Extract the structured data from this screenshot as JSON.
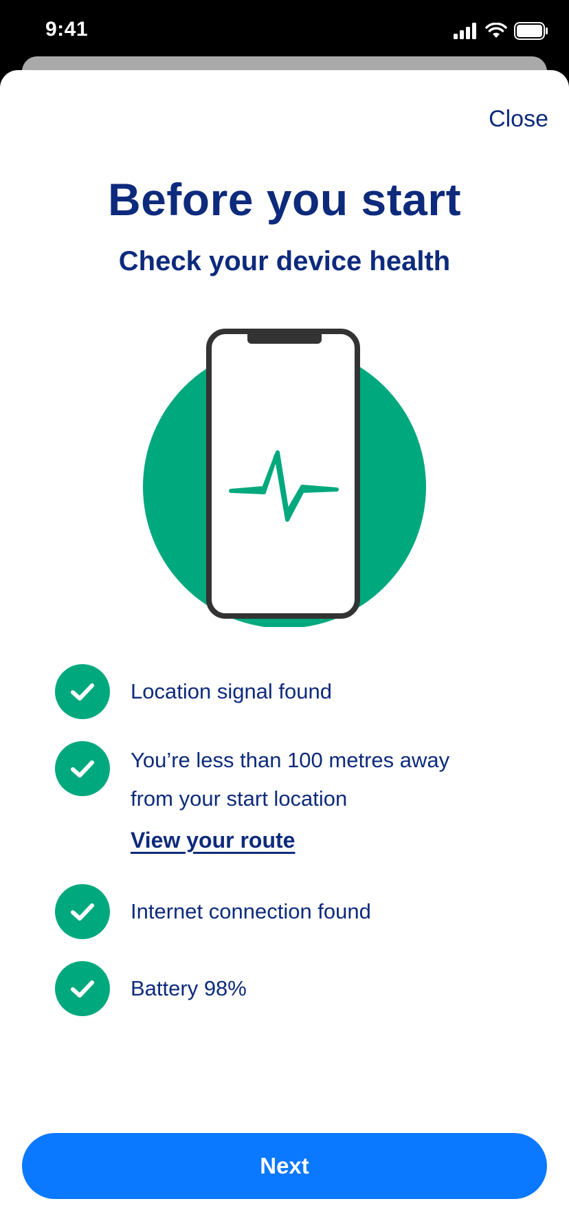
{
  "status_bar": {
    "time": "9:41",
    "icons": [
      "signal-icon",
      "wifi-icon",
      "battery-icon"
    ]
  },
  "header": {
    "close_label": "Close",
    "title": "Before you start",
    "subtitle": "Check your device health"
  },
  "illustration": {
    "icon": "phone-health-icon",
    "circle_color": "#00a87e",
    "pulse_color": "#00a87e"
  },
  "checklist": {
    "items": [
      {
        "label": "Location signal found",
        "icon": "check-icon"
      },
      {
        "label_line1": "You’re less than 100 metres away",
        "label_line2": "from your start location",
        "link": "View your route",
        "icon": "check-icon"
      },
      {
        "label": "Internet connection found",
        "icon": "check-icon"
      },
      {
        "label": "Battery 98%",
        "icon": "check-icon"
      }
    ]
  },
  "footer": {
    "next_label": "Next"
  },
  "colors": {
    "primary_text": "#0d2a7c",
    "success": "#00a87e",
    "button": "#0a78ff"
  }
}
